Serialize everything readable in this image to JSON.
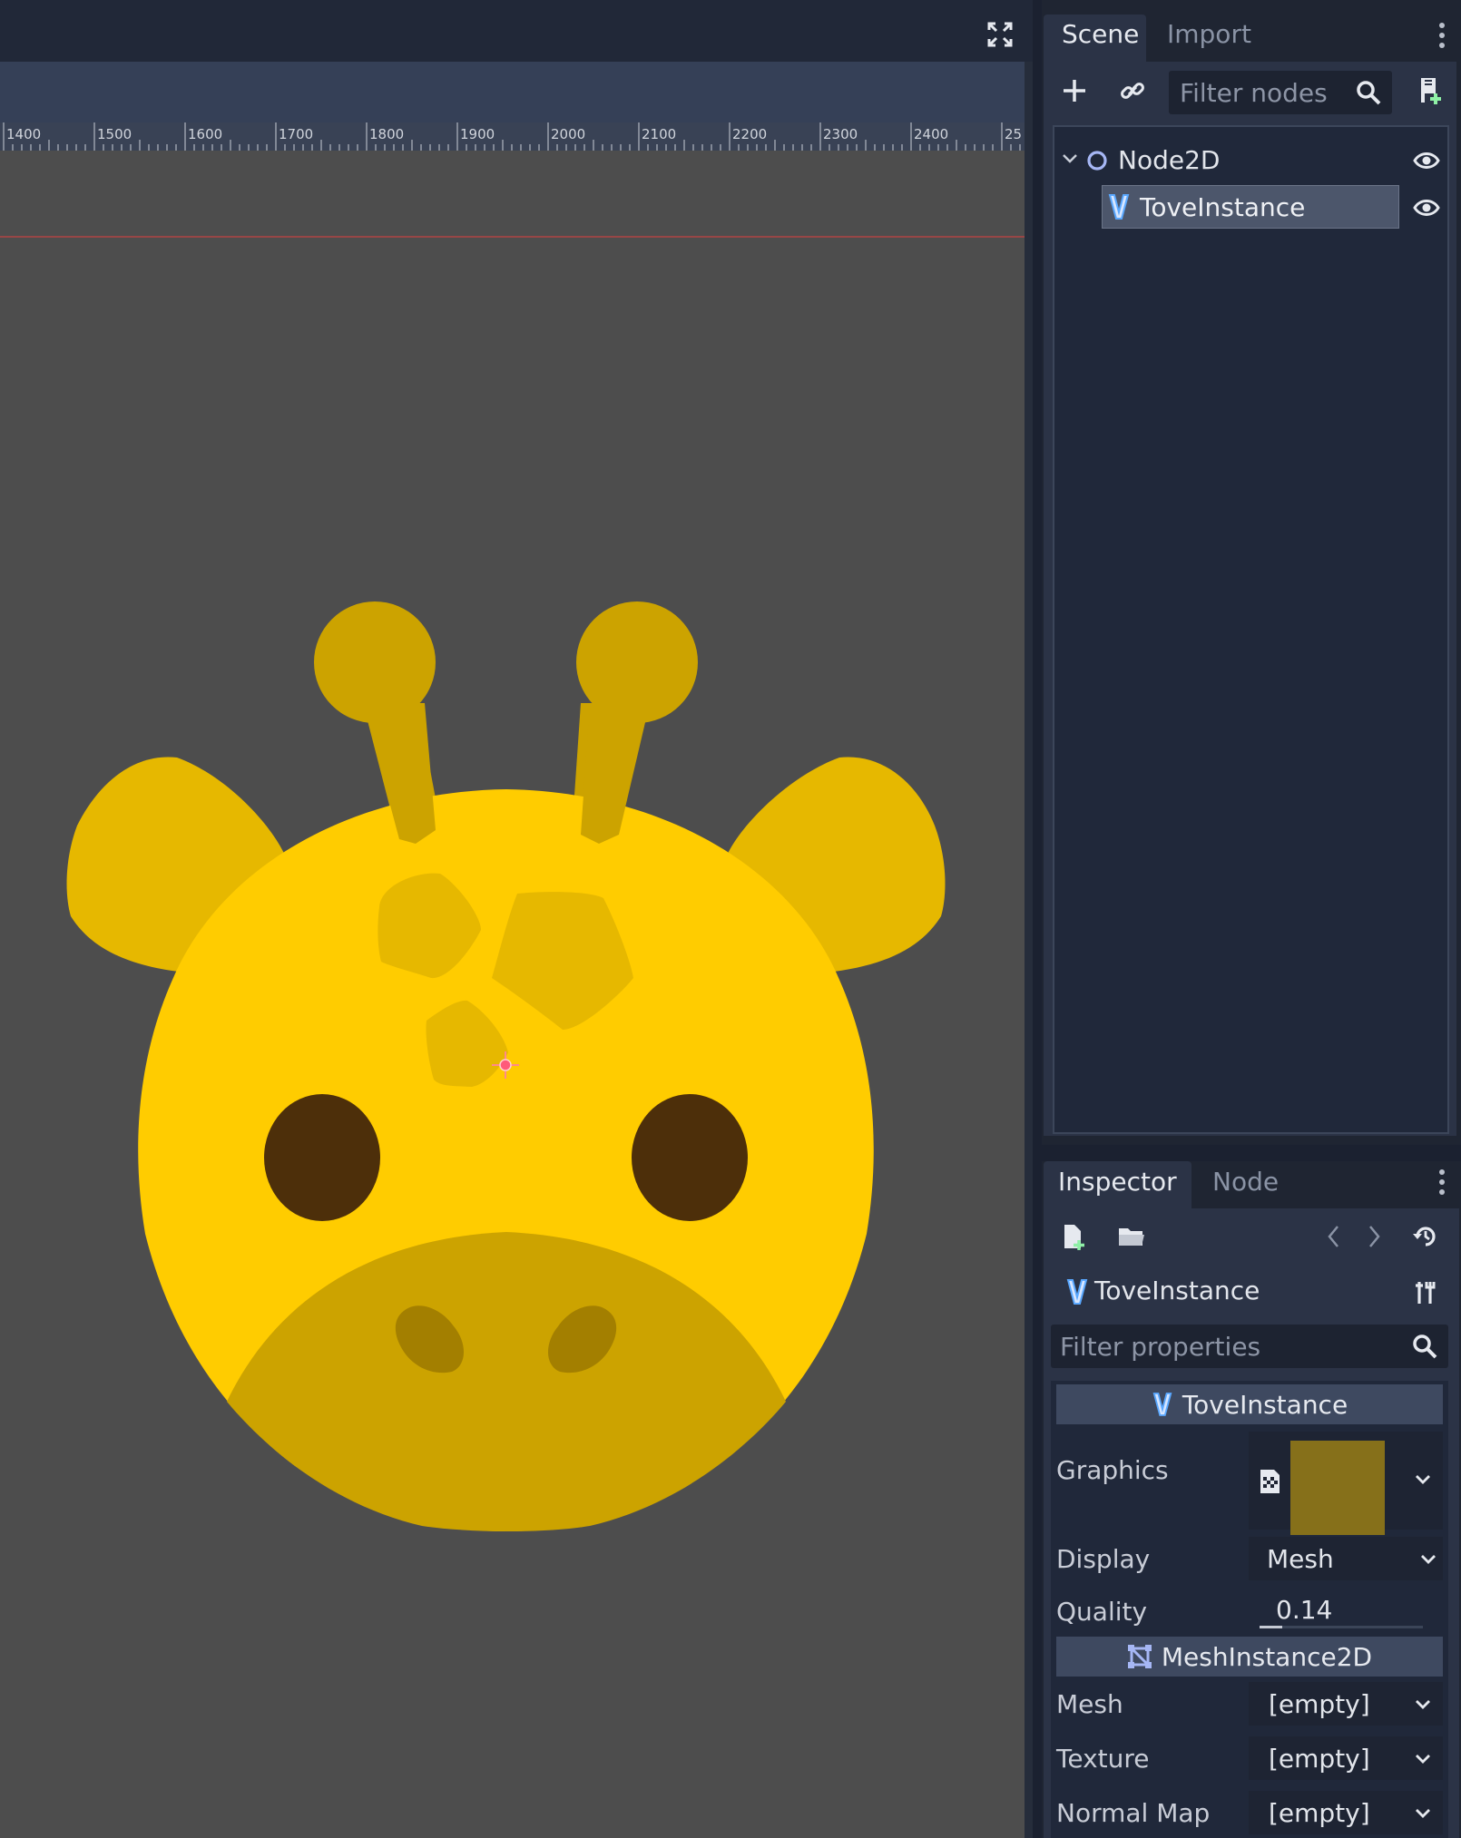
{
  "viewport": {
    "ruler_ticks": [
      "1400",
      "1500",
      "1600",
      "1700",
      "1800",
      "1900",
      "2000",
      "2100",
      "2200",
      "2300",
      "2400",
      "25"
    ],
    "expand_icon": "fullscreen-icon",
    "colors": {
      "canvas": "#4d4d4d",
      "head": "#ffcc00",
      "ears": "#e6b800",
      "ossicones": "#cca300",
      "spots": "#e6b800",
      "muzzle": "#cca300",
      "nostrils": "#a37f00",
      "eyes": "#4d2f0a"
    }
  },
  "scene_dock": {
    "tabs": [
      "Scene",
      "Import"
    ],
    "active_tab": "Scene",
    "toolbar": {
      "add_icon": "plus-icon",
      "link_icon": "link-icon",
      "filter_placeholder": "Filter nodes",
      "search_icon": "search-icon",
      "script_icon": "add-script-icon"
    },
    "tree": [
      {
        "name": "Node2D",
        "icon": "node2d-circle-icon",
        "visible_icon": "eye-icon"
      },
      {
        "name": "ToveInstance",
        "icon": "tove-v-icon",
        "visible_icon": "eye-icon",
        "selected": true
      }
    ]
  },
  "inspector_dock": {
    "tabs": [
      "Inspector",
      "Node"
    ],
    "active_tab": "Inspector",
    "toolbar": {
      "new_resource_icon": "new-resource-icon",
      "open_icon": "folder-icon",
      "back_icon": "chevron-left-icon",
      "forward_icon": "chevron-right-icon",
      "history_icon": "history-icon"
    },
    "object_name": "ToveInstance",
    "tools_icon": "tools-icon",
    "filter_placeholder": "Filter properties",
    "sections": [
      {
        "title": "ToveInstance",
        "icon": "tove-v-icon",
        "properties": [
          {
            "label": "Graphics",
            "type": "resource-preview",
            "preview_color": "#86701a"
          },
          {
            "label": "Display",
            "value": "Mesh"
          },
          {
            "label": "Quality",
            "value": "0.14",
            "slider_fraction": 0.14
          }
        ]
      },
      {
        "title": "MeshInstance2D",
        "icon": "mesh-instance-icon",
        "properties": [
          {
            "label": "Mesh",
            "value": "[empty]"
          },
          {
            "label": "Texture",
            "value": "[empty]"
          },
          {
            "label": "Normal Map",
            "value": "[empty]"
          }
        ]
      }
    ]
  }
}
